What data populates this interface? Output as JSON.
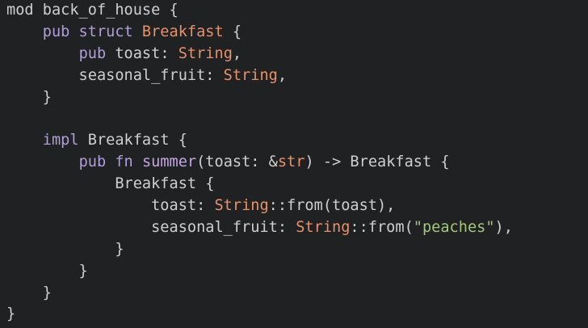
{
  "colors": {
    "background": "#1f2123",
    "default": "#cfcfcf",
    "keyword": "#b39ddb",
    "type": "#e8916a",
    "function": "#c9a5e6",
    "string": "#a6c779"
  },
  "lines": [
    [
      {
        "t": "mod ",
        "k": "default"
      },
      {
        "t": "back_of_house {",
        "k": "default"
      }
    ],
    [
      {
        "t": "    ",
        "k": "default"
      },
      {
        "t": "pub struct ",
        "k": "keyword"
      },
      {
        "t": "Breakfast",
        "k": "type"
      },
      {
        "t": " {",
        "k": "default"
      }
    ],
    [
      {
        "t": "        ",
        "k": "default"
      },
      {
        "t": "pub ",
        "k": "keyword"
      },
      {
        "t": "toast: ",
        "k": "default"
      },
      {
        "t": "String",
        "k": "type"
      },
      {
        "t": ",",
        "k": "default"
      }
    ],
    [
      {
        "t": "        seasonal_fruit: ",
        "k": "default"
      },
      {
        "t": "String",
        "k": "type"
      },
      {
        "t": ",",
        "k": "default"
      }
    ],
    [
      {
        "t": "    }",
        "k": "default"
      }
    ],
    [
      {
        "t": "",
        "k": "default"
      }
    ],
    [
      {
        "t": "    ",
        "k": "default"
      },
      {
        "t": "impl ",
        "k": "keyword"
      },
      {
        "t": "Breakfast {",
        "k": "default"
      }
    ],
    [
      {
        "t": "        ",
        "k": "default"
      },
      {
        "t": "pub fn ",
        "k": "keyword"
      },
      {
        "t": "summer",
        "k": "function"
      },
      {
        "t": "(toast: &",
        "k": "default"
      },
      {
        "t": "str",
        "k": "type"
      },
      {
        "t": ") -> Breakfast {",
        "k": "default"
      }
    ],
    [
      {
        "t": "            Breakfast {",
        "k": "default"
      }
    ],
    [
      {
        "t": "                toast: ",
        "k": "default"
      },
      {
        "t": "String",
        "k": "type"
      },
      {
        "t": "::from(toast),",
        "k": "default"
      }
    ],
    [
      {
        "t": "                seasonal_fruit: ",
        "k": "default"
      },
      {
        "t": "String",
        "k": "type"
      },
      {
        "t": "::from(",
        "k": "default"
      },
      {
        "t": "\"peaches\"",
        "k": "string"
      },
      {
        "t": "),",
        "k": "default"
      }
    ],
    [
      {
        "t": "            }",
        "k": "default"
      }
    ],
    [
      {
        "t": "        }",
        "k": "default"
      }
    ],
    [
      {
        "t": "    }",
        "k": "default"
      }
    ],
    [
      {
        "t": "}",
        "k": "default"
      }
    ]
  ]
}
